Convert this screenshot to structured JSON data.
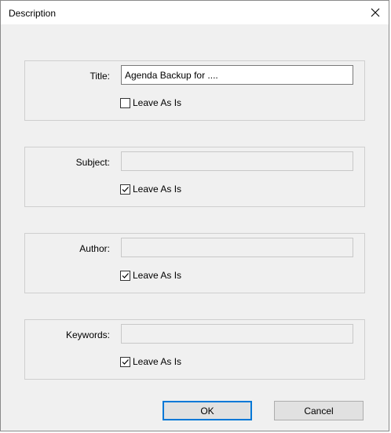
{
  "window": {
    "title": "Description"
  },
  "fields": [
    {
      "label": "Title:",
      "value": "Agenda Backup for ....",
      "checkbox_label": "Leave As Is",
      "checked": false
    },
    {
      "label": "Subject:",
      "value": "",
      "checkbox_label": "Leave As Is",
      "checked": true
    },
    {
      "label": "Author:",
      "value": "",
      "checkbox_label": "Leave As Is",
      "checked": true
    },
    {
      "label": "Keywords:",
      "value": "",
      "checkbox_label": "Leave As Is",
      "checked": true
    }
  ],
  "buttons": {
    "ok_label": "OK",
    "cancel_label": "Cancel"
  },
  "icons": {
    "close": "close-icon",
    "check": "checkmark-icon"
  }
}
